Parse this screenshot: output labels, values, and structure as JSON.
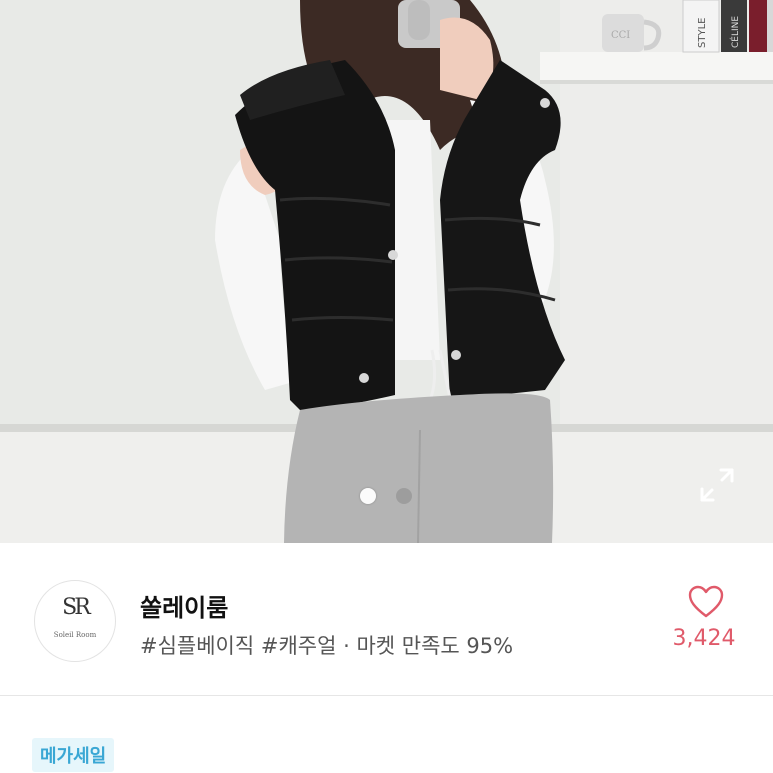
{
  "carousel": {
    "slide_count": 2,
    "active_index": 0,
    "expand_icon": "expand-icon",
    "photo_mug_text": "CCI",
    "photo_book_spines": [
      "STYLE",
      "CÉLINE",
      ""
    ]
  },
  "store": {
    "logo": {
      "monogram": "SR",
      "subtitle": "Soleil Room"
    },
    "name": "쏠레이룸",
    "tags": "#심플베이직 #캐주얼 · 마켓 만족도 95%",
    "like_icon": "heart-outline-icon",
    "like_count": "3,424"
  },
  "badge": {
    "label": "메가세일"
  },
  "colors": {
    "like_accent": "#e05a6a",
    "badge_bg": "#e6f6fb",
    "badge_text": "#3aa7d4"
  }
}
